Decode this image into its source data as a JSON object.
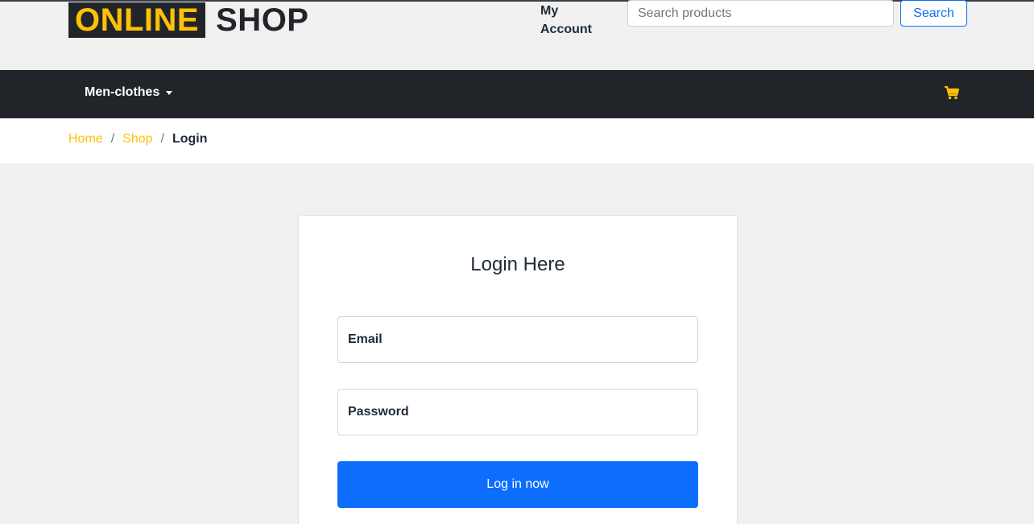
{
  "header": {
    "logo_part1": "ONLINE",
    "logo_part2": "SHOP",
    "my_account": "My Account",
    "search_placeholder": "Search products",
    "search_button": "Search"
  },
  "nav": {
    "menu_label": "Men-clothes",
    "cart_icon": "shopping-cart-icon"
  },
  "breadcrumb": {
    "home": "Home",
    "shop": "Shop",
    "current": "Login"
  },
  "login": {
    "title": "Login Here",
    "email_placeholder": "Email",
    "password_placeholder": "Password",
    "submit": "Log in now"
  },
  "colors": {
    "accent": "#ffc107",
    "dark": "#212529",
    "primary": "#0d6efd"
  }
}
